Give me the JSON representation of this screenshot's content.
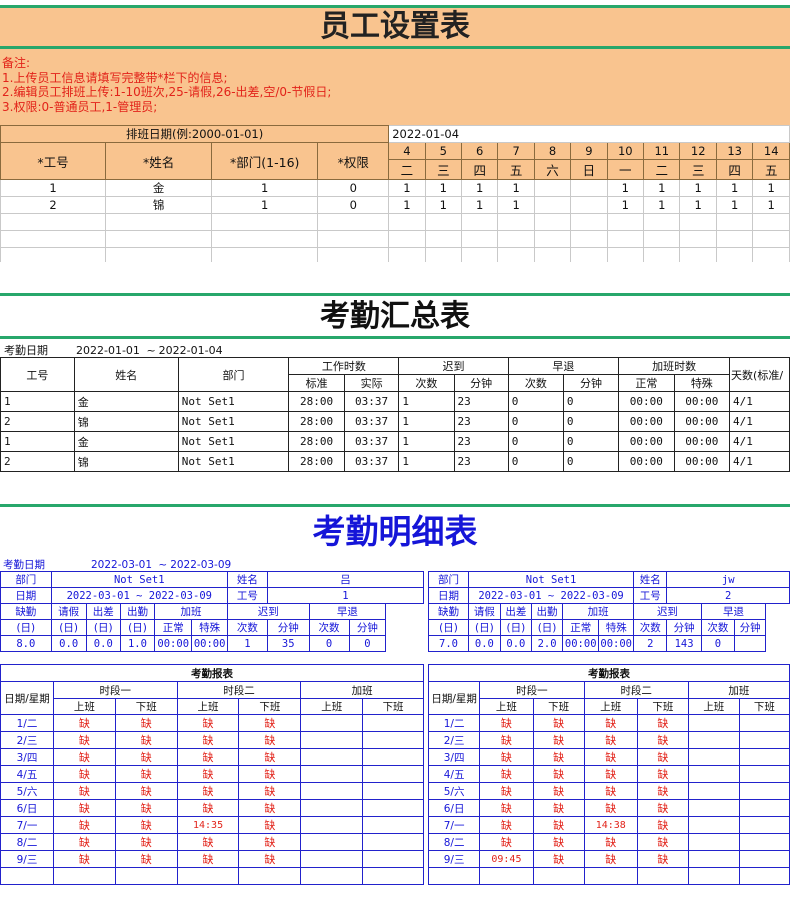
{
  "employee_setup": {
    "title": "员工设置表",
    "notes": [
      "备注:",
      "1.上传员工信息请填写完整带*栏下的信息;",
      "2.编辑员工排班上传:1-10班次,25-请假,26-出差,空/0-节假日;",
      "3.权限:0-普通员工,1-管理员;"
    ],
    "schedule_label": "排班日期(例:2000-01-01)",
    "schedule_date": "2022-01-04",
    "headers": [
      "*工号",
      "*姓名",
      "*部门(1-16)",
      "*权限"
    ],
    "days": [
      "4",
      "5",
      "6",
      "7",
      "8",
      "9",
      "10",
      "11",
      "12",
      "13",
      "14"
    ],
    "weekdays": [
      "二",
      "三",
      "四",
      "五",
      "六",
      "日",
      "一",
      "二",
      "三",
      "四",
      "五"
    ],
    "rows": [
      {
        "id": "1",
        "name": "金",
        "dept": "1",
        "perm": "0",
        "shifts": [
          "1",
          "1",
          "1",
          "1",
          "",
          "",
          "1",
          "1",
          "1",
          "1",
          "1"
        ]
      },
      {
        "id": "2",
        "name": "锦",
        "dept": "1",
        "perm": "0",
        "shifts": [
          "1",
          "1",
          "1",
          "1",
          "",
          "",
          "1",
          "1",
          "1",
          "1",
          "1"
        ]
      }
    ]
  },
  "attendance_summary": {
    "title": "考勤汇总表",
    "date_label": "考勤日期",
    "date_from": "2022-01-01",
    "date_sep": "~",
    "date_to": "2022-01-04",
    "headers": {
      "id": "工号",
      "name": "姓名",
      "dept": "部门",
      "work_hours": "工作时数",
      "standard": "标准",
      "actual": "实际",
      "late": "迟到",
      "early": "早退",
      "count": "次数",
      "minutes": "分钟",
      "overtime": "加班时数",
      "normal": "正常",
      "special": "特殊",
      "days": "天数(标准/"
    },
    "rows": [
      {
        "id": "1",
        "name": "金",
        "dept": "Not Set1",
        "std": "28:00",
        "act": "03:37",
        "late_n": "1",
        "late_m": "23",
        "early_n": "0",
        "early_m": "0",
        "ot_n": "00:00",
        "ot_s": "00:00",
        "days": "4/1"
      },
      {
        "id": "2",
        "name": "锦",
        "dept": "Not Set1",
        "std": "28:00",
        "act": "03:37",
        "late_n": "1",
        "late_m": "23",
        "early_n": "0",
        "early_m": "0",
        "ot_n": "00:00",
        "ot_s": "00:00",
        "days": "4/1"
      },
      {
        "id": "1",
        "name": "金",
        "dept": "Not Set1",
        "std": "28:00",
        "act": "03:37",
        "late_n": "1",
        "late_m": "23",
        "early_n": "0",
        "early_m": "0",
        "ot_n": "00:00",
        "ot_s": "00:00",
        "days": "4/1"
      },
      {
        "id": "2",
        "name": "锦",
        "dept": "Not Set1",
        "std": "28:00",
        "act": "03:37",
        "late_n": "1",
        "late_m": "23",
        "early_n": "0",
        "early_m": "0",
        "ot_n": "00:00",
        "ot_s": "00:00",
        "days": "4/1"
      }
    ]
  },
  "attendance_detail": {
    "title": "考勤明细表",
    "date_label": "考勤日期",
    "date_from": "2022-03-01",
    "date_sep": "~",
    "date_to": "2022-03-09",
    "labels": {
      "dept": "部门",
      "name": "姓名",
      "date": "日期",
      "id": "工号",
      "absent": "缺勤",
      "leave": "请假",
      "trip": "出差",
      "present": "出勤",
      "overtime": "加班",
      "late": "迟到",
      "early": "早退",
      "normal": "正常",
      "special": "特殊",
      "count": "次数",
      "minutes": "分钟",
      "day_unit": "(日)",
      "report": "考勤报表",
      "day_week": "日期/星期",
      "period1": "时段一",
      "period2": "时段二",
      "on": "上班",
      "off": "下班"
    },
    "cards": [
      {
        "dept": "Not Set1",
        "name": "吕",
        "date_range": "2022-03-01 ~ 2022-03-09",
        "id": "1",
        "stats": [
          "8.0",
          "0.0",
          "0.0",
          "1.0",
          "00:00",
          "00:00",
          "1",
          "35",
          "0",
          "0"
        ],
        "report": [
          {
            "day": "1/二",
            "cells": [
              "缺",
              "缺",
              "缺",
              "缺",
              "",
              ""
            ]
          },
          {
            "day": "2/三",
            "cells": [
              "缺",
              "缺",
              "缺",
              "缺",
              "",
              ""
            ]
          },
          {
            "day": "3/四",
            "cells": [
              "缺",
              "缺",
              "缺",
              "缺",
              "",
              ""
            ]
          },
          {
            "day": "4/五",
            "cells": [
              "缺",
              "缺",
              "缺",
              "缺",
              "",
              ""
            ]
          },
          {
            "day": "5/六",
            "cells": [
              "缺",
              "缺",
              "缺",
              "缺",
              "",
              ""
            ]
          },
          {
            "day": "6/日",
            "cells": [
              "缺",
              "缺",
              "缺",
              "缺",
              "",
              ""
            ]
          },
          {
            "day": "7/一",
            "cells": [
              "缺",
              "缺",
              "14:35",
              "缺",
              "",
              ""
            ]
          },
          {
            "day": "8/二",
            "cells": [
              "缺",
              "缺",
              "缺",
              "缺",
              "",
              ""
            ]
          },
          {
            "day": "9/三",
            "cells": [
              "缺",
              "缺",
              "缺",
              "缺",
              "",
              ""
            ]
          }
        ]
      },
      {
        "dept": "Not Set1",
        "name": "jw",
        "date_range": "2022-03-01 ~ 2022-03-09",
        "id": "2",
        "stats": [
          "7.0",
          "0.0",
          "0.0",
          "2.0",
          "00:00",
          "00:00",
          "2",
          "143",
          "0",
          ""
        ],
        "report": [
          {
            "day": "1/二",
            "cells": [
              "缺",
              "缺",
              "缺",
              "缺",
              ""
            ]
          },
          {
            "day": "2/三",
            "cells": [
              "缺",
              "缺",
              "缺",
              "缺",
              ""
            ]
          },
          {
            "day": "3/四",
            "cells": [
              "缺",
              "缺",
              "缺",
              "缺",
              ""
            ]
          },
          {
            "day": "4/五",
            "cells": [
              "缺",
              "缺",
              "缺",
              "缺",
              ""
            ]
          },
          {
            "day": "5/六",
            "cells": [
              "缺",
              "缺",
              "缺",
              "缺",
              ""
            ]
          },
          {
            "day": "6/日",
            "cells": [
              "缺",
              "缺",
              "缺",
              "缺",
              ""
            ]
          },
          {
            "day": "7/一",
            "cells": [
              "缺",
              "缺",
              "14:38",
              "缺",
              ""
            ]
          },
          {
            "day": "8/二",
            "cells": [
              "缺",
              "缺",
              "缺",
              "缺",
              ""
            ]
          },
          {
            "day": "9/三",
            "cells": [
              "09:45",
              "缺",
              "缺",
              "缺",
              ""
            ]
          }
        ]
      }
    ]
  },
  "colors": {
    "orange": "#f9c48f",
    "green_rule": "#27a76b",
    "note_red": "#e2231a",
    "detail_blue": "#1515d8"
  }
}
